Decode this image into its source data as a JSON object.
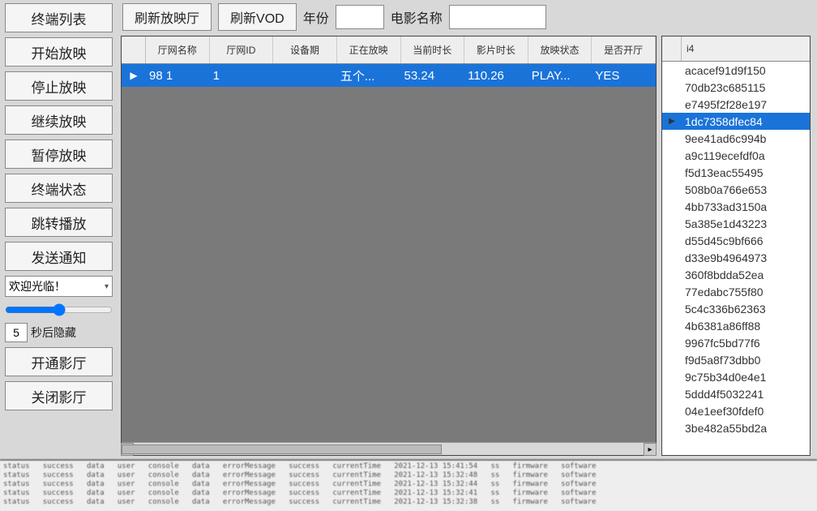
{
  "sidebar": {
    "buttons_top": [
      "终端列表",
      "开始放映",
      "停止放映",
      "继续放映",
      "暂停放映",
      "终端状态",
      "跳转播放",
      "发送通知"
    ],
    "combo": {
      "value": "欢迎光临！"
    },
    "slider": {
      "value": 50
    },
    "seconds": {
      "value": "5",
      "label": "秒后隐藏"
    },
    "buttons_bottom": [
      "开通影厅",
      "关闭影厅"
    ]
  },
  "toolbar": {
    "btn_refresh_hall": "刷新放映厅",
    "btn_refresh_vod": "刷新VOD",
    "lbl_year": "年份",
    "year_value": "",
    "lbl_movie": "电影名称",
    "movie_value": ""
  },
  "grid": {
    "columns": [
      "厅网名称",
      "厅网ID",
      "设备期",
      "正在放映",
      "当前时长",
      "影片时长",
      "放映状态",
      "是否开厅"
    ],
    "rows": [
      {
        "c": [
          "98  1",
          "1",
          "",
          "五个...",
          "53.24",
          "110.26",
          "PLAY...",
          "YES"
        ]
      }
    ],
    "selected": 0
  },
  "side": {
    "header": "i4",
    "items": [
      "acacef91d9f150",
      "70db23c685115",
      "e7495f2f28e197",
      "1dc7358dfec84",
      "9ee41ad6c994b",
      "a9c119ecefdf0a",
      "f5d13eac55495",
      "508b0a766e653",
      "4bb733ad3150a",
      "5a385e1d43223",
      "d55d45c9bf666",
      "d33e9b4964973",
      "360f8bdda52ea",
      "77edabc755f80",
      "5c4c336b62363",
      "4b6381a86ff88",
      "9967fc5bd77f6",
      "f9d5a8f73dbb0",
      "9c75b34d0e4e1",
      "5ddd4f5032241",
      "04e1eef30fdef0",
      "3be482a55bd2a"
    ],
    "selected": 3
  },
  "log_lines": [
    "status   success   data   user   console   data   errorMessage   success   currentTime   2021-12-13 15:41:54   ss   firmware   software",
    "status   success   data   user   console   data   errorMessage   success   currentTime   2021-12-13 15:32:48   ss   firmware   software",
    "status   success   data   user   console   data   errorMessage   success   currentTime   2021-12-13 15:32:44   ss   firmware   software",
    "status   success   data   user   console   data   errorMessage   success   currentTime   2021-12-13 15:32:41   ss   firmware   software",
    "status   success   data   user   console   data   errorMessage   success   currentTime   2021-12-13 15:32:38   ss   firmware   software"
  ]
}
